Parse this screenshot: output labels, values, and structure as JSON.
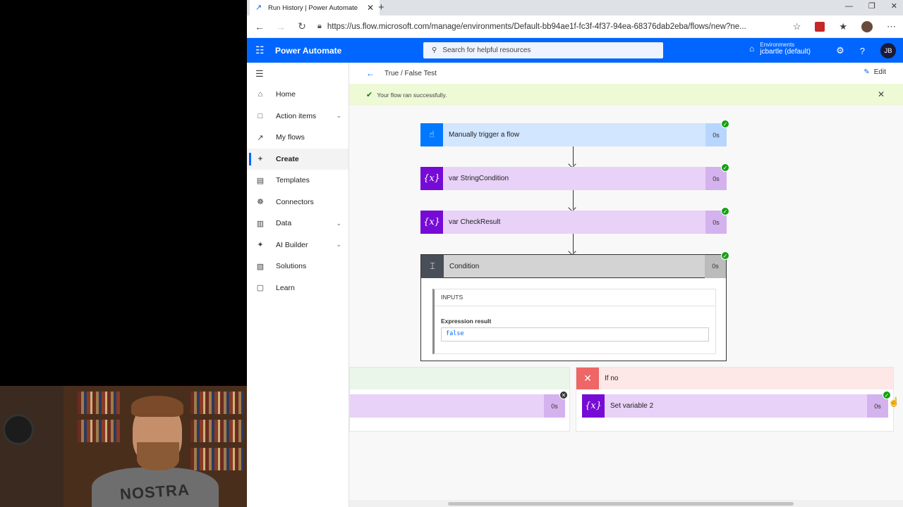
{
  "browser": {
    "tab_title": "Run History | Power Automate",
    "url": "https://us.flow.microsoft.com/manage/environments/Default-bb94ae1f-fc3f-4f37-94ea-68376dab2eba/flows/new?ne..."
  },
  "header": {
    "brand": "Power Automate",
    "search_placeholder": "Search for helpful resources",
    "env_label": "Environments",
    "env_value": "jcbartle (default)",
    "avatar_initials": "JB"
  },
  "sidebar": {
    "items": [
      {
        "label": "Home",
        "icon": "home-icon"
      },
      {
        "label": "Action items",
        "icon": "clipboard-icon"
      },
      {
        "label": "My flows",
        "icon": "flow-icon"
      },
      {
        "label": "Create",
        "icon": "plus-icon"
      },
      {
        "label": "Templates",
        "icon": "templates-icon"
      },
      {
        "label": "Connectors",
        "icon": "connectors-icon"
      },
      {
        "label": "Data",
        "icon": "database-icon"
      },
      {
        "label": "AI Builder",
        "icon": "ai-icon"
      },
      {
        "label": "Solutions",
        "icon": "solutions-icon"
      },
      {
        "label": "Learn",
        "icon": "book-icon"
      }
    ]
  },
  "main": {
    "breadcrumb": "True / False Test",
    "edit_label": "Edit",
    "success_message": "Your flow ran successfully.",
    "steps": {
      "trigger": {
        "label": "Manually trigger a flow",
        "duration": "0s"
      },
      "var1": {
        "label": "var StringCondition",
        "duration": "0s"
      },
      "var2": {
        "label": "var CheckResult",
        "duration": "0s"
      },
      "condition": {
        "label": "Condition",
        "duration": "0s"
      }
    },
    "condition_inputs": {
      "header": "INPUTS",
      "expression_label": "Expression result",
      "expression_value": "false"
    },
    "branch_yes": {
      "duration": "0s"
    },
    "branch_no": {
      "label": "If no",
      "action_label": "Set variable 2",
      "action_duration": "0s"
    }
  },
  "webcam": {
    "shirt_text": "NOSTRA"
  }
}
